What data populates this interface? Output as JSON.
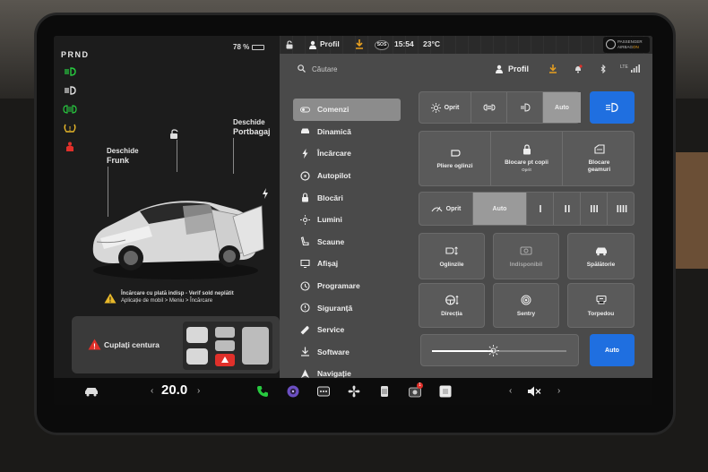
{
  "left": {
    "gear_selector": "PRND",
    "battery": "78 %",
    "battery_level": 0.78,
    "frunk_action": "Deschide",
    "frunk_name": "Frunk",
    "trunk_action": "Deschide",
    "trunk_name": "Portbagaj",
    "charge_warning_line1": "Încărcare cu plată indisp - Verif sold neplătit",
    "charge_warning_line2": "Aplicație de mobil > Meniu > Încărcare",
    "seatbelt_warning": "Cuplați centura"
  },
  "topbar": {
    "profile": "Profil",
    "sos": "SOS",
    "time": "15:54",
    "temperature": "23°C",
    "airbag_line1": "PASSENGER",
    "airbag_line2_prefix": "AIRBAG",
    "airbag_line2_state": "ON"
  },
  "search": {
    "placeholder": "Căutare"
  },
  "profile_label": "Profil",
  "network": "LTE",
  "menu": [
    {
      "label": "Comenzi",
      "icon": "toggle-icon",
      "active": true
    },
    {
      "label": "Dinamică",
      "icon": "car-icon"
    },
    {
      "label": "Încărcare",
      "icon": "bolt-icon"
    },
    {
      "label": "Autopilot",
      "icon": "steering-icon"
    },
    {
      "label": "Blocări",
      "icon": "lock-icon"
    },
    {
      "label": "Lumini",
      "icon": "sun-icon"
    },
    {
      "label": "Scaune",
      "icon": "seat-icon"
    },
    {
      "label": "Afișaj",
      "icon": "display-icon"
    },
    {
      "label": "Programare",
      "icon": "clock-icon"
    },
    {
      "label": "Siguranță",
      "icon": "shield-icon"
    },
    {
      "label": "Service",
      "icon": "wrench-icon"
    },
    {
      "label": "Software",
      "icon": "download-icon"
    },
    {
      "label": "Navigație",
      "icon": "navigation-icon"
    }
  ],
  "lights": {
    "off": "Oprit",
    "auto": "Auto"
  },
  "actions": {
    "fold_mirrors": "Pliere oglinzi",
    "child_lock": "Blocare pt copii",
    "child_lock_state": "Oprit",
    "window_lock_line1": "Blocare",
    "window_lock_line2": "geamuri"
  },
  "wipers": {
    "off": "Oprit",
    "auto": "Auto"
  },
  "grid": {
    "mirrors": "Oglinzile",
    "dashcam": "Indisponibil",
    "wash": "Spălătorie",
    "steering": "Direcția",
    "sentry": "Sentry",
    "dashboard": "Torpedou"
  },
  "brightness": {
    "auto": "Auto",
    "level": 0.45
  },
  "dock": {
    "temperature": "20.0",
    "prev": "‹",
    "next": "›",
    "camera_badge": "1"
  },
  "colors": {
    "accent_blue": "#1f6fe0",
    "indicator_green": "#27c93f",
    "warning_red": "#e0302a",
    "warning_yellow": "#e8b82a"
  }
}
